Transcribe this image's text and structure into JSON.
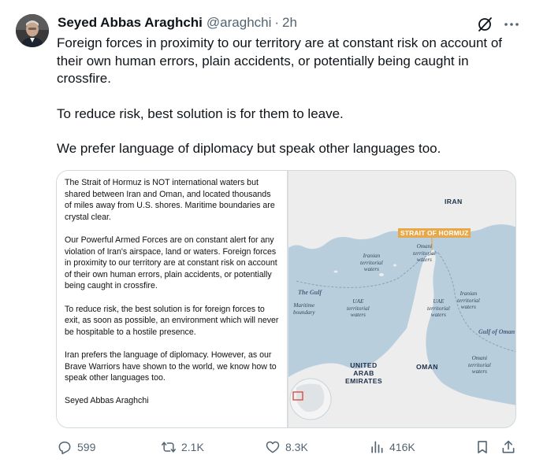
{
  "author": {
    "name": "Seyed Abbas Araghchi",
    "handle": "@araghchi",
    "separator": "·",
    "time": "2h"
  },
  "icons": {
    "grok": "grok-icon",
    "more": "more-icon",
    "reply": "reply-icon",
    "retweet": "retweet-icon",
    "like": "heart-icon",
    "views": "views-icon",
    "bookmark": "bookmark-icon",
    "share": "share-icon"
  },
  "tweet": {
    "paragraphs": [
      "Foreign forces in proximity to our territory are at constant risk on account of their own human errors, plain accidents, or potentially being caught in crossfire.",
      "To reduce risk, best solution is for them to leave.",
      "We prefer language of diplomacy but speak other languages too."
    ]
  },
  "media": {
    "text": {
      "paragraphs": [
        "The Strait of Hormuz is NOT international waters but shared between Iran and Oman, and located thousands of miles away from U.S. shores. Maritime boundaries are crystal clear.",
        "Our Powerful Armed Forces are on constant alert for any violation of Iran's airspace, land or waters. Foreign forces in proximity to our territory are at constant risk on account of their own human errors, plain accidents, or potentially being caught in crossfire.",
        "To reduce risk, the best solution is for foreign forces to exit, as soon as possible, an environment which will never be hospitable to a hostile presence.",
        "Iran prefers the language of diplomacy. However, as our Brave Warriors have shown to the world, we know how to speak other languages too."
      ],
      "signature": "Seyed Abbas Araghchi"
    },
    "map": {
      "labels": {
        "iran": "IRAN",
        "strait": "STRAIT OF HORMUZ",
        "omani_waters_1": "Omani",
        "omani_waters_2": "territorial",
        "omani_waters_3": "waters",
        "iranian_waters_a1": "Iranian",
        "iranian_waters_a2": "territorial",
        "iranian_waters_a3": "waters",
        "the_gulf": "The Gulf",
        "maritime_1": "Maritime",
        "maritime_2": "boundary",
        "uae_waters_a1": "UAE",
        "uae_waters_a2": "territorial",
        "uae_waters_a3": "waters",
        "uae_waters_b1": "UAE",
        "uae_waters_b2": "territorial",
        "uae_waters_b3": "waters",
        "iranian_waters_b1": "Iranian",
        "iranian_waters_b2": "territorial",
        "iranian_waters_b3": "waters",
        "gulf_of_oman": "Gulf of Oman",
        "uae_1": "UNITED",
        "uae_2": "ARAB",
        "uae_3": "EMIRATES",
        "oman": "OMAN",
        "omani_waters_b1": "Omani",
        "omani_waters_b2": "territorial",
        "omani_waters_b3": "waters"
      },
      "colors": {
        "sea": "#b9cedd",
        "land": "#ecedec",
        "accent": "#e8a84a"
      }
    }
  },
  "actions": {
    "replies": "599",
    "reposts": "2.1K",
    "likes": "8.3K",
    "views": "416K"
  }
}
